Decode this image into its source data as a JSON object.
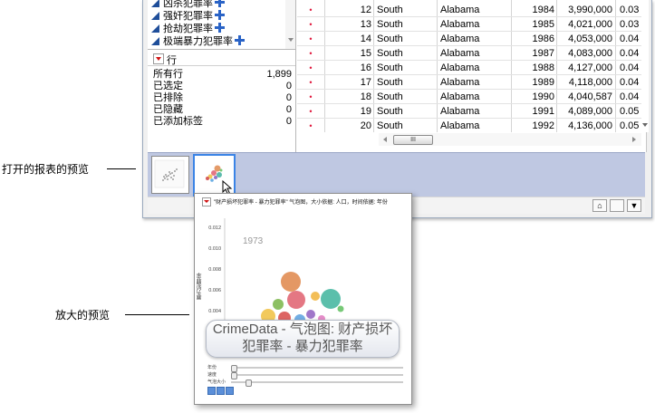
{
  "columns_panel": {
    "items": [
      {
        "label": "凶杀犯罪率"
      },
      {
        "label": "强奸犯罪率"
      },
      {
        "label": "抢劫犯罪率"
      },
      {
        "label": "极端暴力犯罪率"
      }
    ]
  },
  "rows_panel": {
    "header": "行",
    "stats": [
      {
        "label": "所有行",
        "value": "1,899"
      },
      {
        "label": "已选定",
        "value": "0"
      },
      {
        "label": "已排除",
        "value": "0"
      },
      {
        "label": "已隐藏",
        "value": "0"
      },
      {
        "label": "已添加标签",
        "value": "0"
      }
    ]
  },
  "table": {
    "rows": [
      {
        "marker": "•",
        "row": "12",
        "region": "South",
        "state": "Alabama",
        "year": "1984",
        "population": "3,990,000",
        "rate": "0.03"
      },
      {
        "marker": "•",
        "row": "13",
        "region": "South",
        "state": "Alabama",
        "year": "1985",
        "population": "4,021,000",
        "rate": "0.03"
      },
      {
        "marker": "•",
        "row": "14",
        "region": "South",
        "state": "Alabama",
        "year": "1986",
        "population": "4,053,000",
        "rate": "0.04"
      },
      {
        "marker": "•",
        "row": "15",
        "region": "South",
        "state": "Alabama",
        "year": "1987",
        "population": "4,083,000",
        "rate": "0.04"
      },
      {
        "marker": "•",
        "row": "16",
        "region": "South",
        "state": "Alabama",
        "year": "1988",
        "population": "4,127,000",
        "rate": "0.04"
      },
      {
        "marker": "•",
        "row": "17",
        "region": "South",
        "state": "Alabama",
        "year": "1989",
        "population": "4,118,000",
        "rate": "0.04"
      },
      {
        "marker": "•",
        "row": "18",
        "region": "South",
        "state": "Alabama",
        "year": "1990",
        "population": "4,040,587",
        "rate": "0.04"
      },
      {
        "marker": "•",
        "row": "19",
        "region": "South",
        "state": "Alabama",
        "year": "1991",
        "population": "4,089,000",
        "rate": "0.05"
      },
      {
        "marker": "•",
        "row": "20",
        "region": "South",
        "state": "Alabama",
        "year": "1992",
        "population": "4,136,000",
        "rate": "0.05"
      }
    ],
    "scroll_thumb": "III"
  },
  "popup": {
    "title": "\"财产损坏犯罪率 - 暴力犯罪率\" 气泡图，大小依据: 人口，时间依据: 年份",
    "year": "1973",
    "y_ticks": [
      "0.012",
      "0.010",
      "0.008",
      "0.006",
      "0.004"
    ],
    "y_label": "暴力犯罪率",
    "caption_line1": "CrimeData - 气泡图: 财产损坏",
    "caption_line2": "犯罪率 - 暴力犯罪率",
    "controls": [
      {
        "label": "年份"
      },
      {
        "label": "速度"
      },
      {
        "label": "气泡大小"
      }
    ]
  },
  "callouts": {
    "open_reports": "打开的报表的预览",
    "enlarged": "放大的预览"
  },
  "colors": {
    "marker": "#e0163b",
    "strip": "#bfc8e2",
    "thumb_selected_border": "#3b84e6"
  }
}
